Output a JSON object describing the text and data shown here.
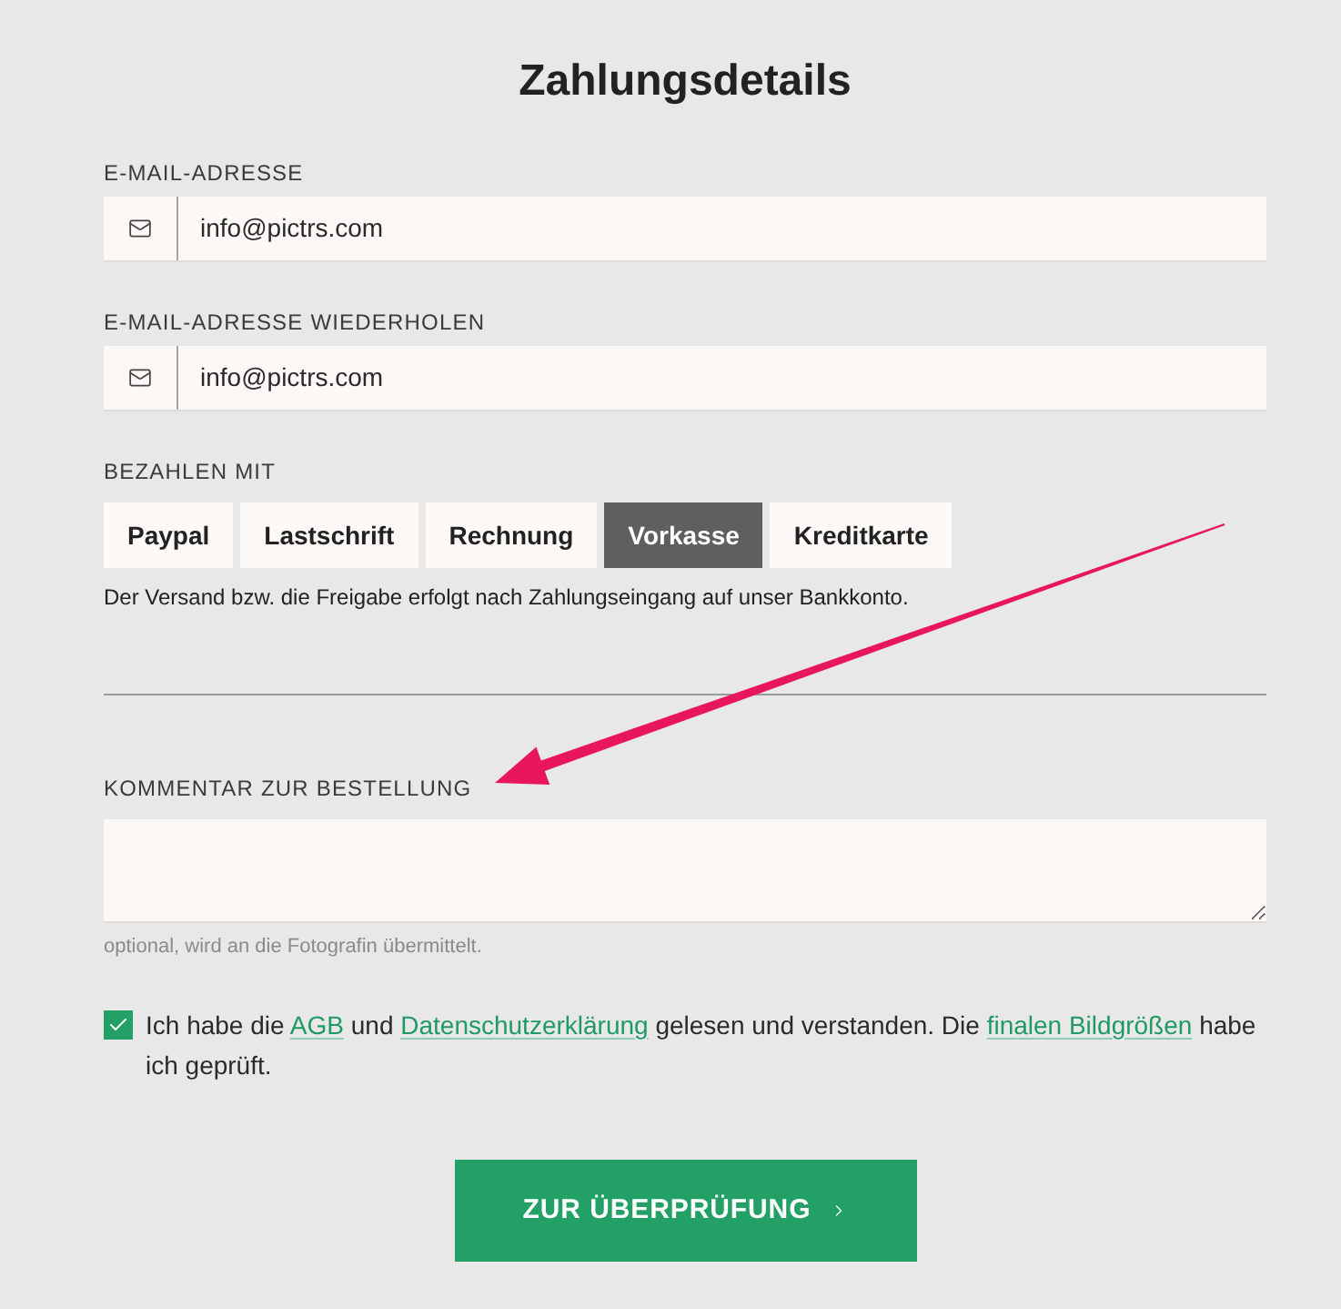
{
  "title": "Zahlungsdetails",
  "email_fields": [
    {
      "label": "E-MAIL-ADRESSE",
      "value": "info@pictrs.com"
    },
    {
      "label": "E-MAIL-ADRESSE WIEDERHOLEN",
      "value": "info@pictrs.com"
    }
  ],
  "payment": {
    "label": "BEZAHLEN MIT",
    "options": [
      {
        "label": "Paypal",
        "selected": false
      },
      {
        "label": "Lastschrift",
        "selected": false
      },
      {
        "label": "Rechnung",
        "selected": false
      },
      {
        "label": "Vorkasse",
        "selected": true
      },
      {
        "label": "Kreditkarte",
        "selected": false
      }
    ],
    "note": "Der Versand bzw. die Freigabe erfolgt nach Zahlungseingang auf unser Bankkonto."
  },
  "comment": {
    "label": "KOMMENTAR ZUR BESTELLUNG",
    "hint": "optional, wird an die Fotografin übermittelt."
  },
  "consent": {
    "checked": true,
    "parts": [
      {
        "kind": "text",
        "text": "Ich habe die "
      },
      {
        "kind": "link",
        "text": "AGB"
      },
      {
        "kind": "text",
        "text": " und "
      },
      {
        "kind": "link",
        "text": "Datenschutzerklärung"
      },
      {
        "kind": "text",
        "text": " gelesen und verstanden. Die "
      },
      {
        "kind": "link",
        "text": "finalen Bildgrößen"
      },
      {
        "kind": "text",
        "text": " habe ich geprüft."
      }
    ]
  },
  "submit_button": {
    "label": "ZUR ÜBERPRÜFUNG"
  }
}
